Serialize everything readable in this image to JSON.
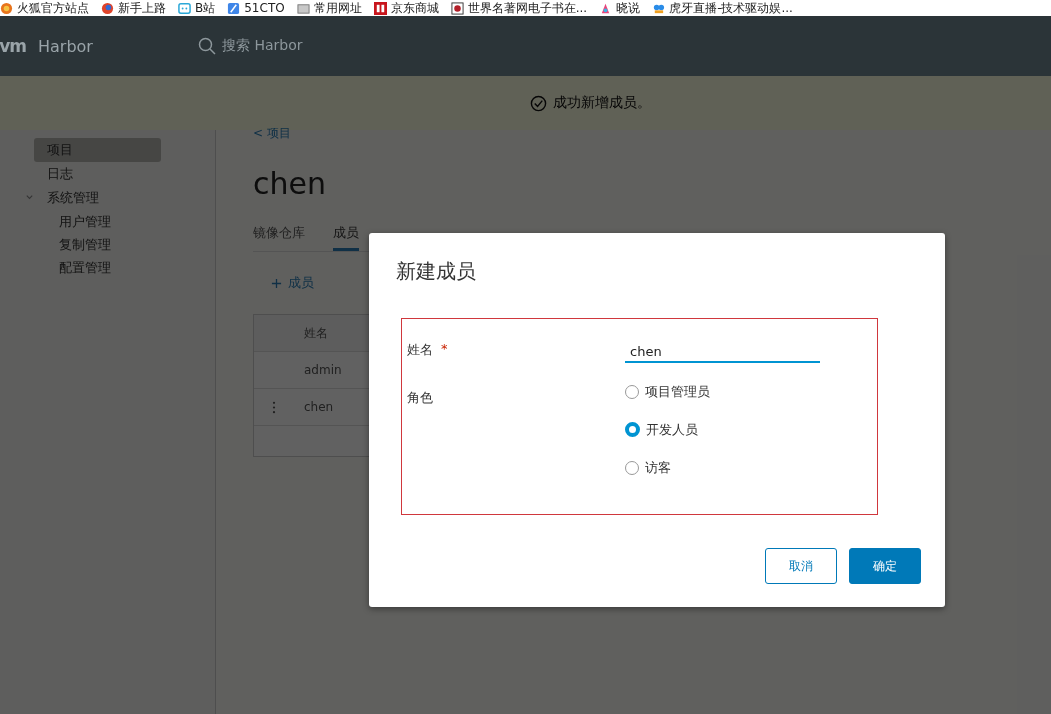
{
  "bookmarks": [
    {
      "label": "火狐官方站点"
    },
    {
      "label": "新手上路"
    },
    {
      "label": "B站"
    },
    {
      "label": "51CTO"
    },
    {
      "label": "常用网址"
    },
    {
      "label": "京东商城"
    },
    {
      "label": "世界名著网电子书在..."
    },
    {
      "label": "晓说"
    },
    {
      "label": "虎牙直播-技术驱动娱..."
    }
  ],
  "header": {
    "logo": "vm",
    "title": "Harbor",
    "search_placeholder": "搜索 Harbor"
  },
  "notification": {
    "message": "成功新增成员。"
  },
  "sidebar": {
    "items": [
      {
        "label": "项目",
        "selected": true
      },
      {
        "label": "日志",
        "selected": false
      },
      {
        "label": "系统管理",
        "selected": false,
        "expanded": true,
        "children": [
          {
            "label": "用户管理",
            "selected": false
          },
          {
            "label": "复制管理",
            "selected": false
          },
          {
            "label": "配置管理",
            "selected": false
          }
        ]
      }
    ]
  },
  "breadcrumb": "< 项目",
  "project_title": "chen",
  "tabs": [
    {
      "label": "镜像仓库",
      "selected": false
    },
    {
      "label": "成员",
      "selected": true
    }
  ],
  "add_member_button": "成员",
  "table": {
    "columns": [
      "姓名"
    ],
    "rows": [
      {
        "menu": false,
        "name": "admin"
      },
      {
        "menu": true,
        "name": "chen"
      }
    ]
  },
  "dialog": {
    "title": "新建成员",
    "annotation_frame": true,
    "name_field": {
      "label": "姓名",
      "required_mark": "*",
      "value": "chen",
      "focused": true
    },
    "role_field": {
      "label": "角色",
      "options": [
        {
          "label": "项目管理员",
          "selected": false
        },
        {
          "label": "开发人员",
          "selected": true
        },
        {
          "label": "访客",
          "selected": false
        }
      ]
    },
    "buttons": [
      {
        "label": "取消",
        "kind": "secondary"
      },
      {
        "label": "确定",
        "kind": "primary"
      }
    ]
  }
}
